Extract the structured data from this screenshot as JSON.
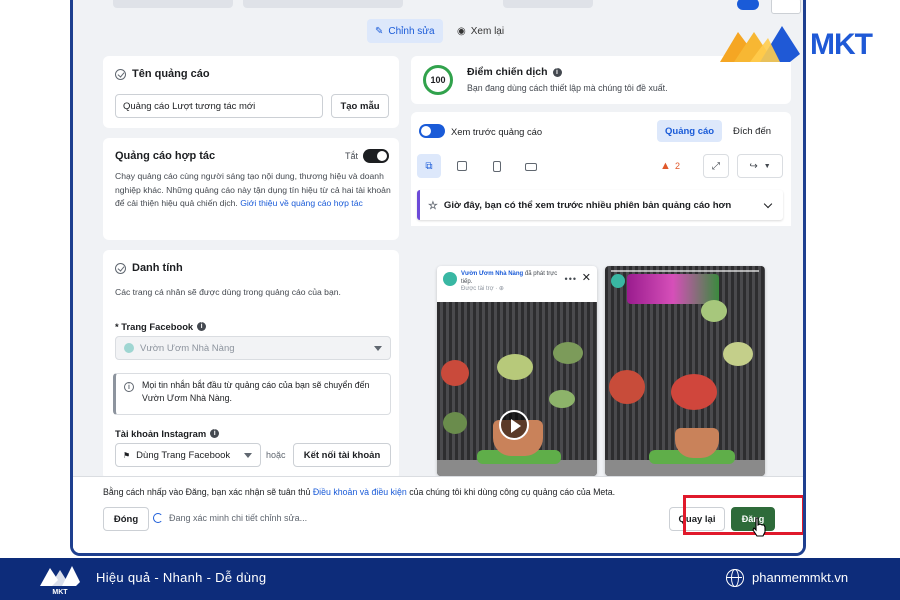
{
  "tabs": {
    "edit_label": "Chỉnh sửa",
    "review_label": "Xem lại"
  },
  "ad_name": {
    "title": "Tên quảng cáo",
    "value": "Quảng cáo Lượt tương tác mới",
    "template_button": "Tạo mẫu"
  },
  "partnership": {
    "title": "Quảng cáo hợp tác",
    "toggle_label": "Tắt",
    "description": "Chạy quảng cáo cùng người sáng tạo nội dung, thương hiệu và doanh nghiệp khác. Những quảng cáo này tận dụng tín hiệu từ cả hai tài khoản để cải thiện hiệu quả chiến dịch.",
    "link": "Giới thiệu về quảng cáo hợp tác"
  },
  "identity": {
    "title": "Danh tính",
    "description": "Các trang cá nhân sẽ được dùng trong quảng cáo của bạn.",
    "facebook_label": "* Trang Facebook",
    "facebook_value": "Vườn Ươm Nhà Nàng",
    "notice": "Mọi tin nhắn bắt đầu từ quảng cáo của bạn sẽ chuyển đến Vườn Ươm Nhà Nàng.",
    "instagram_label": "Tài khoản Instagram",
    "instagram_value": "Dùng Trang Facebook",
    "or_text": "hoặc",
    "connect_button": "Kết nối tài khoản"
  },
  "campaign_score": {
    "score": "100",
    "title": "Điểm chiến dịch",
    "subtitle": "Bạn đang dùng cách thiết lập mà chúng tôi đề xuất."
  },
  "preview": {
    "toggle_label": "Xem trước quảng cáo",
    "tab_ad": "Quảng cáo",
    "tab_destination": "Đích đến",
    "warning_count": "2",
    "banner_text": "Giờ đây, bạn có thể xem trước nhiều phiên bản quảng cáo hơn",
    "post_page": "Vườn Ươm Nhà Nàng",
    "post_suffix": "đã phát trực tiếp.",
    "post_meta": "Được tài trợ · ⊕"
  },
  "footer": {
    "terms_prefix": "Bằng cách nhấp vào Đăng, bạn xác nhận sẽ tuân thủ",
    "terms_link": "Điều khoản và điều kiện",
    "terms_suffix": "của chúng tôi khi dùng công cụ quảng cáo của Meta.",
    "close_button": "Đóng",
    "loading_text": "Đang xác minh chi tiết chỉnh sửa...",
    "back_button": "Quay lại",
    "publish_button": "Đăng"
  },
  "brand": {
    "logo_text": "MKT",
    "slogan": "Hiệu quả - Nhanh - Dễ dùng",
    "website": "phanmemmkt.vn"
  },
  "colors": {
    "accent": "#1a5bd8",
    "brand_band": "#0d2c7a",
    "highlight": "#e0192b",
    "publish": "#2e6b3a",
    "score_ring": "#31a24c"
  }
}
